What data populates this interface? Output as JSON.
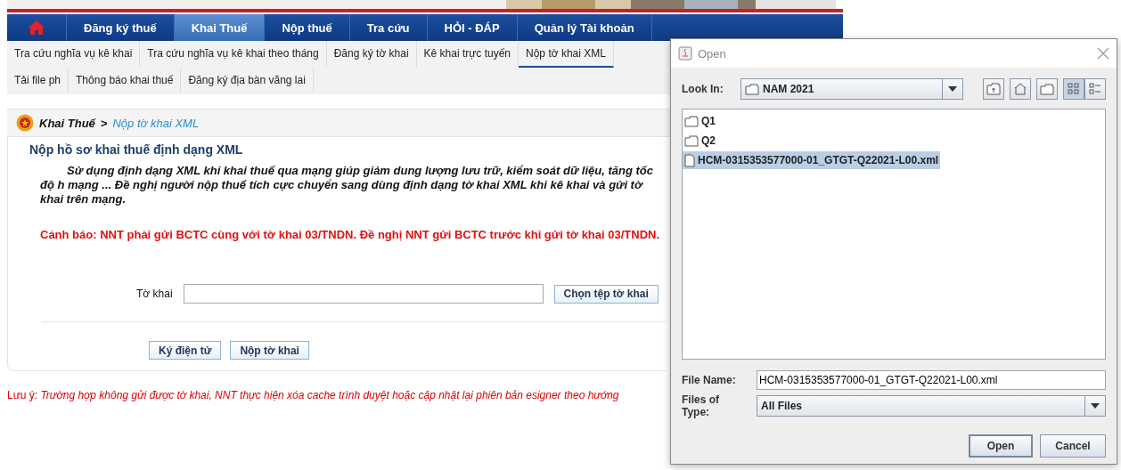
{
  "banner": {
    "kind": "picture"
  },
  "main_nav": [
    {
      "kind": "home",
      "selected": false
    },
    {
      "kind": "text",
      "label": "Đăng ký thuế",
      "selected": false
    },
    {
      "kind": "text",
      "label": "Khai Thuế",
      "selected": true
    },
    {
      "kind": "text",
      "label": "Nộp thuế",
      "selected": false
    },
    {
      "kind": "text",
      "label": "Tra cứu",
      "selected": false
    },
    {
      "kind": "text",
      "label": "HỎI - ĐÁP",
      "selected": false
    },
    {
      "kind": "text",
      "label": "Quản lý Tài khoản",
      "selected": false
    }
  ],
  "sub_nav": [
    {
      "label": "Tra cứu nghĩa vụ kê khai",
      "selected": false
    },
    {
      "label": "Tra cứu nghĩa vụ kê khai theo tháng",
      "selected": false
    },
    {
      "label": "Đăng ký tờ khai",
      "selected": false
    },
    {
      "label": "Kê khai trực tuyến",
      "selected": false
    },
    {
      "label": "Nộp tờ khai XML",
      "selected": true
    },
    {
      "label": "Tải file ph",
      "selected": false
    },
    {
      "label": "Thông báo khai thuế",
      "selected": false
    },
    {
      "label": "Đăng ký địa bàn vãng lai",
      "selected": false
    }
  ],
  "breadcrumb": {
    "parent": "Khai Thuế",
    "separator": ">",
    "current": "Nộp tờ khai XML"
  },
  "section_title": "Nộp hồ sơ khai thuế định dạng XML",
  "intro": "Sử dụng định dạng XML khi khai thuế qua mạng giúp giảm dung lượng lưu trữ, kiểm soát dữ liệu, tăng tốc độ h mạng ... Đề nghị người nộp thuế tích cực chuyển sang dùng định dạng tờ khai XML khi kê khai và gửi tờ khai trên mạng.",
  "warning": "Cảnh báo: NNT phải gửi BCTC cùng với tờ khai 03/TNDN. Đề nghị NNT gửi BCTC trước khi gửi tờ khai 03/TNDN.",
  "form": {
    "label": "Tờ khai",
    "browse_button": "Chọn tệp tờ khai"
  },
  "actions": [
    "Ký điện tử",
    "Nộp tờ khai"
  ],
  "note": {
    "label": "Lưu ý:",
    "text": "Trường hợp không gửi được tờ khai, NNT thực hiện xóa cache trình duyệt hoặc cập nhật lại phiên bản esigner theo hướng"
  },
  "dialog": {
    "title": "Open",
    "look_in": {
      "label": "Look In:",
      "value": "NAM 2021"
    },
    "files": [
      {
        "kind": "folder",
        "name": "Q1",
        "selected": false
      },
      {
        "kind": "folder",
        "name": "Q2",
        "selected": false
      },
      {
        "kind": "file",
        "name": "HCM-0315353577000-01_GTGT-Q22021-L00.xml",
        "selected": true
      }
    ],
    "file_name": {
      "label": "File Name:",
      "value": "HCM-0315353577000-01_GTGT-Q22021-L00.xml"
    },
    "file_type": {
      "label": "Files of Type:",
      "value": "All Files"
    },
    "buttons": [
      "Open",
      "Cancel"
    ]
  }
}
